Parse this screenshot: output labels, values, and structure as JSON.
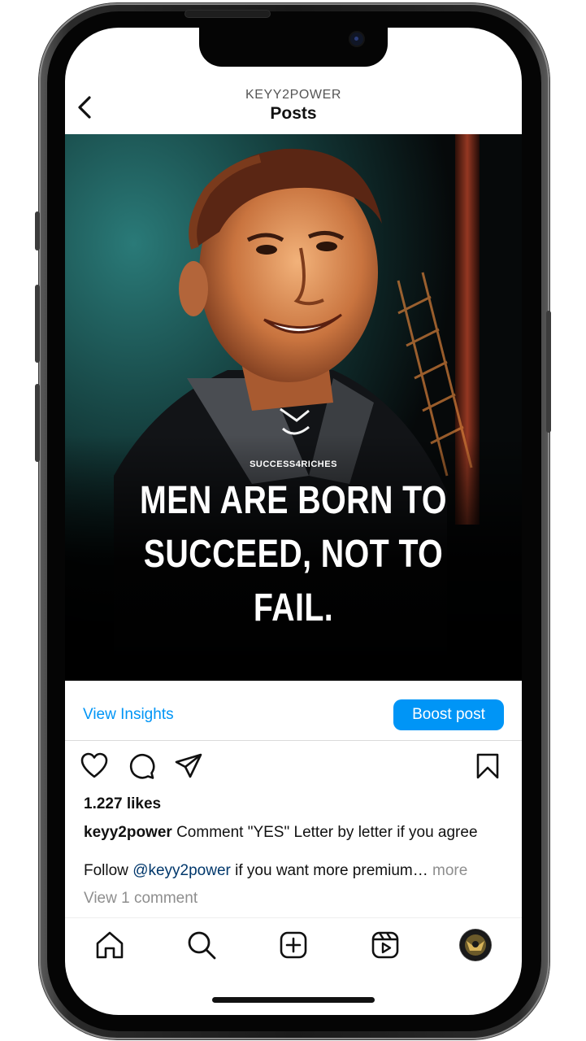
{
  "header": {
    "username": "KEYY2POWER",
    "title": "Posts",
    "back_icon": "chevron-left-icon"
  },
  "post": {
    "watermark": "SUCCESS4RICHES",
    "quote_lines": [
      "MEN ARE BORN TO",
      "SUCCEED, NOT TO",
      "FAIL."
    ]
  },
  "insights": {
    "view_insights_label": "View Insights",
    "boost_label": "Boost post"
  },
  "actions": {
    "icons": [
      "heart-icon",
      "comment-icon",
      "share-icon",
      "bookmark-icon"
    ]
  },
  "details": {
    "likes": "1.227 likes",
    "caption_user": "keyy2power",
    "caption_text": "Comment \"YES\" Letter by letter if you agree",
    "follow_prefix": "Follow",
    "mention": "@keyy2power",
    "follow_suffix": "if you want more premium…",
    "more_label": "more",
    "view_comments": "View 1 comment"
  },
  "nav": {
    "icons": [
      "home-icon",
      "search-icon",
      "create-icon",
      "reels-icon",
      "profile-avatar"
    ]
  },
  "colors": {
    "accent": "#0095f6",
    "mention": "#00376b",
    "muted": "#8e8e8e"
  }
}
